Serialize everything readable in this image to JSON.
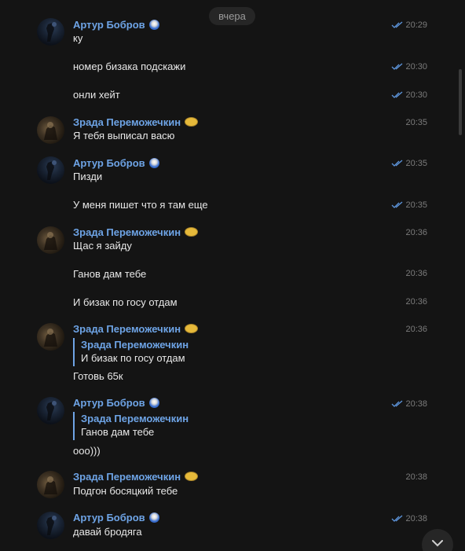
{
  "date_separator": "вчера",
  "icons": {
    "read_check": "double-check-icon",
    "scroll_down": "chevron-down-icon",
    "badge_artur": "blue-emoji-badge-icon",
    "badge_zrada": "gold-emoji-badge-icon"
  },
  "colors": {
    "background": "#141414",
    "name": "#6ea4e6",
    "text": "#e8e8e8",
    "time": "#7b7b7b",
    "check": "#5d95dc"
  },
  "users": {
    "artur": "Артур Бобров",
    "zrada": "Зрада Переможечкин"
  },
  "messages": [
    {
      "author": "Артур Бобров",
      "text": "ку",
      "time": "20:29",
      "read": true
    },
    {
      "text": "номер бизака подскажи",
      "time": "20:30",
      "read": true
    },
    {
      "text": "онли хейт",
      "time": "20:30",
      "read": true
    },
    {
      "author": "Зрада Переможечкин",
      "text": "Я тебя выписал васю",
      "time": "20:35"
    },
    {
      "author": "Артур Бобров",
      "text": "Пизди",
      "time": "20:35",
      "read": true
    },
    {
      "text": "У меня пишет что я там еще",
      "time": "20:35",
      "read": true
    },
    {
      "author": "Зрада Переможечкин",
      "text": "Щас я зайду",
      "time": "20:36"
    },
    {
      "text": "Ганов дам тебе",
      "time": "20:36"
    },
    {
      "text": "И бизак по госу отдам",
      "time": "20:36"
    },
    {
      "author": "Зрада Переможечкин",
      "reply_author": "Зрада Переможечкин",
      "reply_text": "И бизак по госу отдам",
      "text": "Готовь 65к",
      "time": "20:36"
    },
    {
      "author": "Артур Бобров",
      "reply_author": "Зрада Переможечкин",
      "reply_text": "Ганов дам тебе",
      "text": "ооо)))",
      "time": "20:38",
      "read": true
    },
    {
      "author": "Зрада Переможечкин",
      "text": "Подгон босяцкий тебе",
      "time": "20:38"
    },
    {
      "author": "Артур Бобров",
      "text": "давай бродяга",
      "time": "20:38",
      "read": true
    }
  ]
}
